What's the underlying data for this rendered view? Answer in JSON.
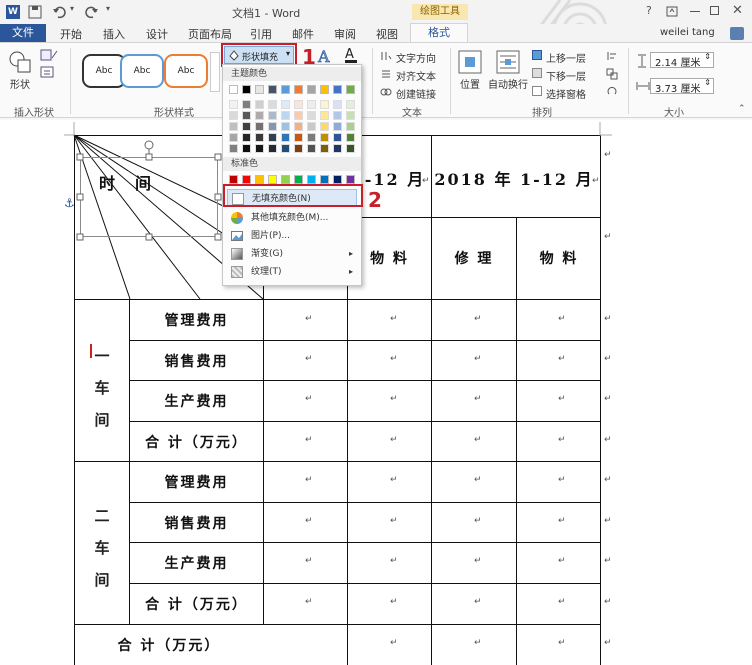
{
  "window": {
    "title": "文档1 - Word",
    "contextual_tab_group": "绘图工具",
    "help": "?",
    "user": "weilei tang"
  },
  "tabs": [
    "文件",
    "开始",
    "插入",
    "设计",
    "页面布局",
    "引用",
    "邮件",
    "审阅",
    "视图",
    "格式"
  ],
  "ribbon": {
    "insert_shapes": {
      "button": "形状",
      "group": "插入形状"
    },
    "shape_styles": {
      "samples": [
        "Abc",
        "Abc",
        "Abc"
      ],
      "shape_fill_button": "形状填充",
      "group": "形状样式"
    },
    "text": {
      "text_direction": "文字方向",
      "align_text": "对齐文本",
      "create_link": "创建链接",
      "group": "文本"
    },
    "arrange": {
      "position": "位置",
      "wrap_text": "自动换行",
      "bring_forward": "上移一层",
      "send_backward": "下移一层",
      "selection_pane": "选择窗格",
      "group": "排列"
    },
    "size": {
      "height": "2.14 厘米",
      "width": "3.73 厘米",
      "group": "大小"
    }
  },
  "menu": {
    "theme_colors_header": "主题颜色",
    "standard_colors_header": "标准色",
    "items": [
      {
        "label": "无填充颜色(N)"
      },
      {
        "label": "其他填充颜色(M)..."
      },
      {
        "label": "图片(P)..."
      },
      {
        "label": "渐变(G)"
      },
      {
        "label": "纹理(T)"
      }
    ],
    "theme_colors": [
      [
        "#ffffff",
        "#000000",
        "#e7e6e6",
        "#44546a",
        "#5b9bd5",
        "#ed7d31",
        "#a5a5a5",
        "#ffc000",
        "#4472c4",
        "#70ad47"
      ],
      [
        "#f2f2f2",
        "#7f7f7f",
        "#d0cece",
        "#d6dce4",
        "#ddebf7",
        "#fce4d6",
        "#ededed",
        "#fff2cc",
        "#d9e1f2",
        "#e2efda"
      ],
      [
        "#d9d9d9",
        "#595959",
        "#aeaaaa",
        "#acb9ca",
        "#bdd7ee",
        "#f8cbad",
        "#dbdbdb",
        "#ffe699",
        "#b4c6e7",
        "#c6e0b4"
      ],
      [
        "#bfbfbf",
        "#404040",
        "#757171",
        "#8497b0",
        "#9bc2e6",
        "#f4b084",
        "#c9c9c9",
        "#ffd966",
        "#8ea9db",
        "#a9d08e"
      ],
      [
        "#a6a6a6",
        "#262626",
        "#3a3838",
        "#333f4f",
        "#2f75b5",
        "#c65911",
        "#7b7b7b",
        "#bf8f00",
        "#305496",
        "#548235"
      ],
      [
        "#808080",
        "#0d0d0d",
        "#161616",
        "#222b35",
        "#1f4e78",
        "#833c0c",
        "#525252",
        "#7f6000",
        "#203764",
        "#375623"
      ]
    ],
    "standard_colors": [
      "#c00000",
      "#ff0000",
      "#ffc000",
      "#ffff00",
      "#92d050",
      "#00b050",
      "#00b0f0",
      "#0070c0",
      "#002060",
      "#7030a0"
    ]
  },
  "annotations": [
    "1",
    "2"
  ],
  "table": {
    "header_time": "时　间",
    "header_2017": "-12 月",
    "header_2018": "2018 年 1-12 月",
    "subheaders": [
      "物 料",
      "修 理",
      "物 料"
    ],
    "workshop1": "一\n车\n间",
    "workshop2": "二\n车\n间",
    "rows": [
      "管理费用",
      "销售费用",
      "生产费用",
      "合 计（万元）",
      "管理费用",
      "销售费用",
      "生产费用",
      "合 计（万元）"
    ],
    "total_label": "合 计（万元）"
  }
}
